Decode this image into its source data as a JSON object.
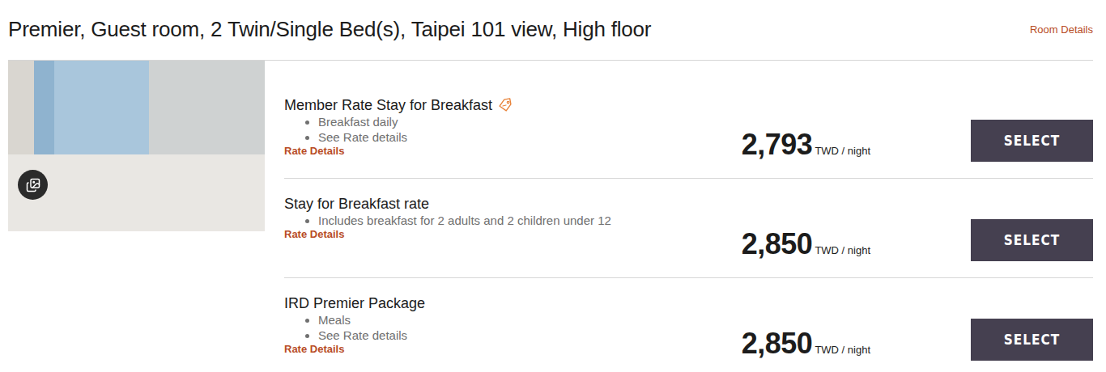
{
  "room": {
    "title": "Premier, Guest room, 2 Twin/Single Bed(s), Taipei 101 view, High floor",
    "details_link": "Room Details"
  },
  "rates": [
    {
      "name": "Member Rate Stay for Breakfast",
      "member": true,
      "features": [
        "Breakfast daily",
        "See Rate details"
      ],
      "details_link": "Rate Details",
      "price": "2,793",
      "unit": "TWD / night",
      "button": "SELECT"
    },
    {
      "name": "Stay for Breakfast rate",
      "member": false,
      "features": [
        "Includes breakfast for 2 adults and 2 children under 12"
      ],
      "details_link": "Rate Details",
      "price": "2,850",
      "unit": "TWD / night",
      "button": "SELECT"
    },
    {
      "name": "IRD Premier Package",
      "member": false,
      "features": [
        "Meals",
        "See Rate details"
      ],
      "details_link": "Rate Details",
      "price": "2,850",
      "unit": "TWD / night",
      "button": "SELECT"
    }
  ]
}
